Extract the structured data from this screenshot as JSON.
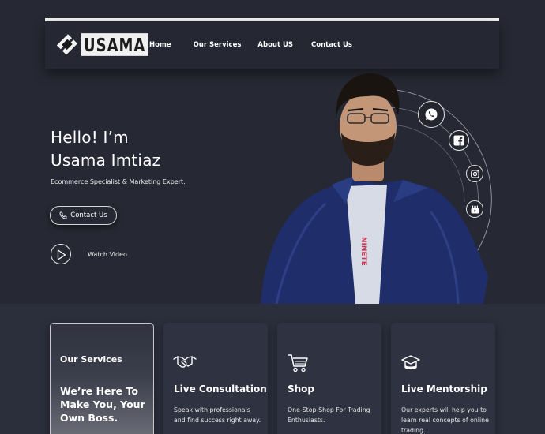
{
  "header": {
    "logo_text": "USAMA",
    "nav": [
      "Home",
      "Our Services",
      "About US",
      "Contact Us"
    ]
  },
  "hero": {
    "greeting": "Hello! I’m",
    "name": "Usama Imtiaz",
    "tagline": "Ecommerce Specialist & Marketing Expert.",
    "contact_label": "Contact Us",
    "watch_label": "Watch Video",
    "shirt_text": "NINETE",
    "social_icons": [
      "whatsapp-icon",
      "facebook-icon",
      "instagram-icon",
      "youtube-icon"
    ]
  },
  "services": {
    "label": "Our Services",
    "headline": "We’re Here To Make You, Your Own Boss.",
    "cards": [
      {
        "icon": "handshake-icon",
        "title": "Live Consultation",
        "desc": "Speak with professionals and find success right away."
      },
      {
        "icon": "cart-icon",
        "title": "Shop",
        "desc": "One-Stop-Shop For Trading Enthusiasts."
      },
      {
        "icon": "graduation-cap-icon",
        "title": "Live Mentorship",
        "desc": "Our experts will help you to learn real concepts of online trading."
      }
    ]
  },
  "colors": {
    "background": "#262833",
    "section": "#2b2e3b",
    "card": "#2f3240",
    "shirt": "#1f2d6a"
  }
}
